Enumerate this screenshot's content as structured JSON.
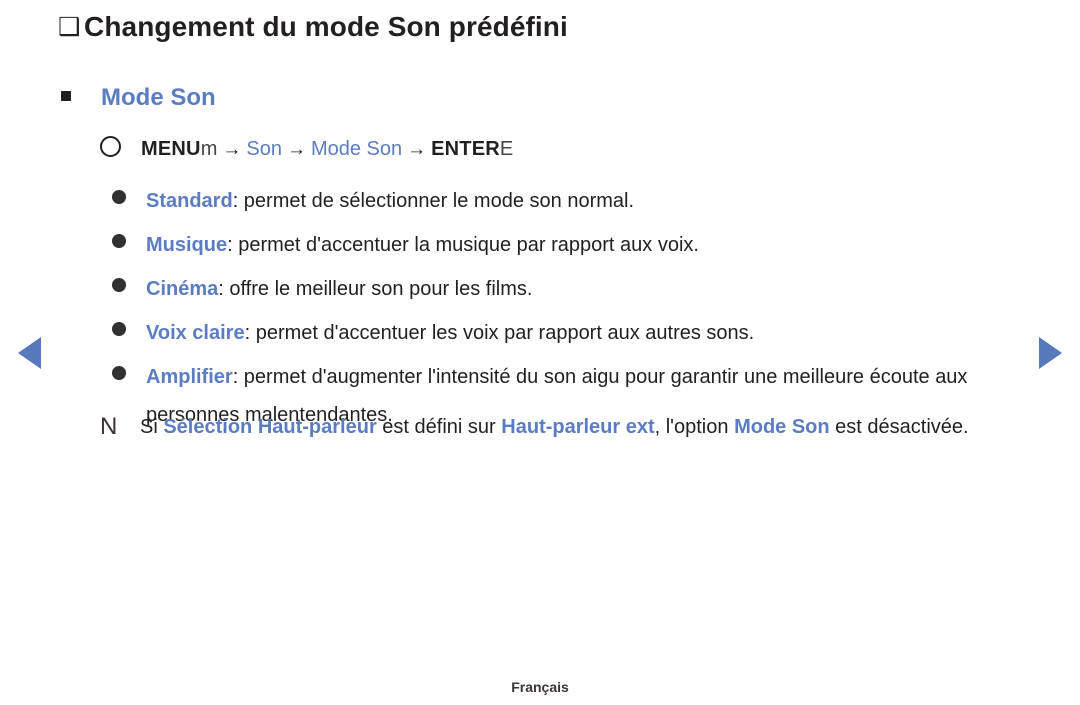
{
  "page": {
    "title_bullet_icon": "hollow-square-icon",
    "title": "Changement du mode Son prédéfini",
    "footer": "Français",
    "accent_color": "#5b7cc4",
    "text_color": "#231f20",
    "nav_arrow_color": "#5878bc",
    "background": "#ffffff"
  },
  "section": {
    "bullet_icon": "filled-square-icon",
    "heading": "Mode Son"
  },
  "menu_path": {
    "circle_icon": "hollow-circle-icon",
    "menu_key": "MENU",
    "menu_key_glyph": "m",
    "arrow_1": "→",
    "step_1": "Son",
    "arrow_2": "→",
    "step_2": "Mode Son",
    "arrow_3": "→",
    "enter_key": "ENTER",
    "enter_key_glyph": "E"
  },
  "options": [
    {
      "bullet_icon": "round-bullet-icon",
      "name": "Standard",
      "description": ": permet de sélectionner le mode son normal."
    },
    {
      "bullet_icon": "round-bullet-icon",
      "name": "Musique",
      "description": ": permet d'accentuer la musique par rapport aux voix."
    },
    {
      "bullet_icon": "round-bullet-icon",
      "name": "Cinéma",
      "description": ": offre le meilleur son pour les films."
    },
    {
      "bullet_icon": "round-bullet-icon",
      "name": "Voix claire",
      "description": ": permet d'accentuer les voix par rapport aux autres sons."
    },
    {
      "bullet_icon": "round-bullet-icon",
      "name": "Amplifier",
      "description": ": permet d'augmenter l'intensité du son aigu pour garantir une meilleure écoute aux personnes malentendantes."
    }
  ],
  "note": {
    "glyph": "N",
    "part_1": "Si ",
    "highlight_1": "Sélection Haut-parleur",
    "part_2": " est défini sur ",
    "highlight_2": "Haut-parleur ext",
    "part_3": ", l'option ",
    "highlight_3": "Mode Son",
    "part_4": " est désactivée."
  },
  "navigation": {
    "prev_label": "◀",
    "next_label": "▶"
  }
}
